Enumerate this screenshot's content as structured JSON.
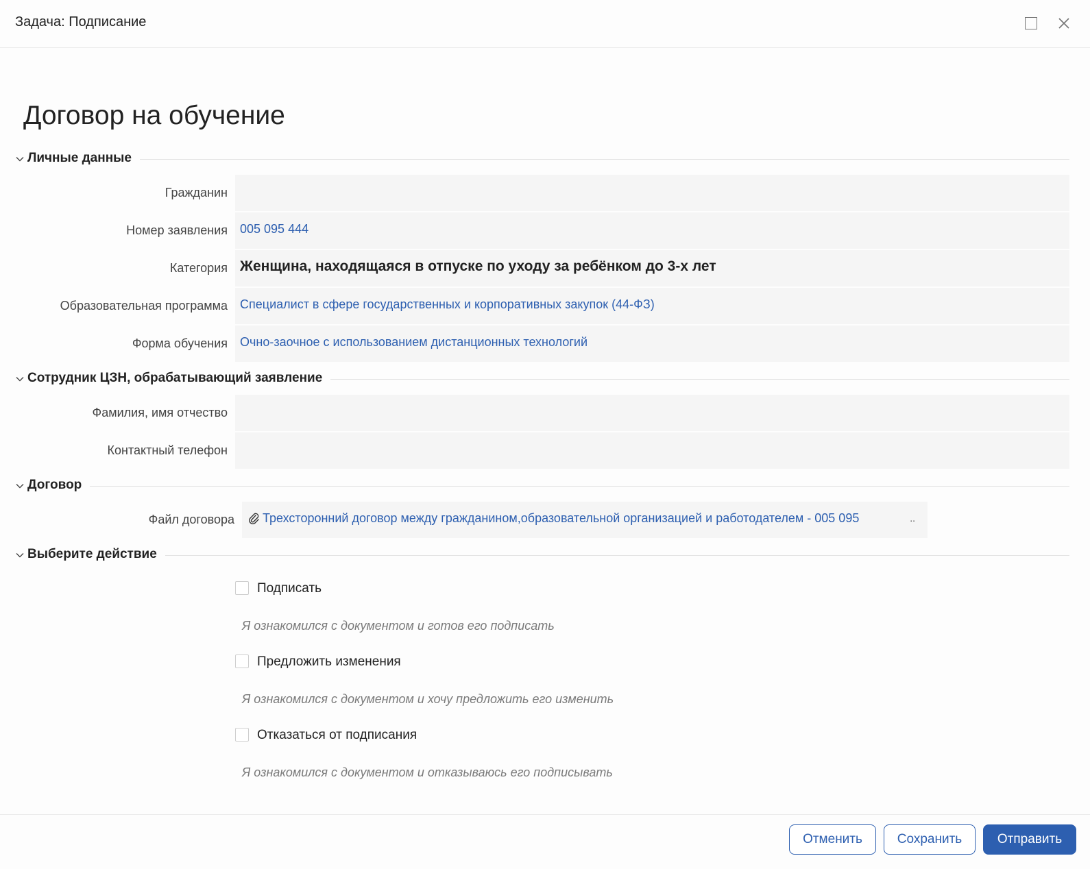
{
  "window": {
    "title": "Задача: Подписание"
  },
  "document": {
    "title": "Договор на обучение"
  },
  "sections": {
    "personal": {
      "title": "Личные данные",
      "citizen_label": "Гражданин",
      "citizen_value": "",
      "application_label": "Номер заявления",
      "application_value": "005 095 444",
      "category_label": "Категория",
      "category_value": "Женщина, находящаяся в отпуске по уходу за ребёнком до 3-х лет",
      "program_label": "Образовательная программа",
      "program_value": "Специалист в сфере государственных и корпоративных закупок (44-ФЗ)",
      "form_label": "Форма обучения",
      "form_value": "Очно-заочное с использованием дистанционных технологий"
    },
    "employee": {
      "title": "Сотрудник ЦЗН, обрабатывающий заявление",
      "name_label": "Фамилия, имя отчество",
      "name_value": "",
      "phone_label": "Контактный телефон",
      "phone_value": ""
    },
    "contract": {
      "title": "Договор",
      "file_label": "Файл договора",
      "file_value": "Трехсторонний договор между гражданином,образовательной организацией и работодателем - 005 095",
      "file_more": ".."
    },
    "action": {
      "title": "Выберите действие",
      "options": [
        {
          "label": "Подписать",
          "hint": "Я ознакомился с документом и готов его подписать",
          "checked": false
        },
        {
          "label": "Предложить изменения",
          "hint": "Я ознакомился с документом и хочу предложить его изменить",
          "checked": false
        },
        {
          "label": "Отказаться от подписания",
          "hint": "Я ознакомился с документом и отказываюсь его подписывать",
          "checked": false
        }
      ]
    }
  },
  "footer": {
    "cancel": "Отменить",
    "save": "Сохранить",
    "send": "Отправить"
  },
  "colors": {
    "accent": "#2d5fb0",
    "field_bg": "#f5f5f5",
    "hint": "#7a7a7a"
  },
  "icons": {
    "maximize": "maximize-icon",
    "close": "close-icon",
    "chevron": "chevron-down-icon",
    "attachment": "paperclip-icon"
  }
}
